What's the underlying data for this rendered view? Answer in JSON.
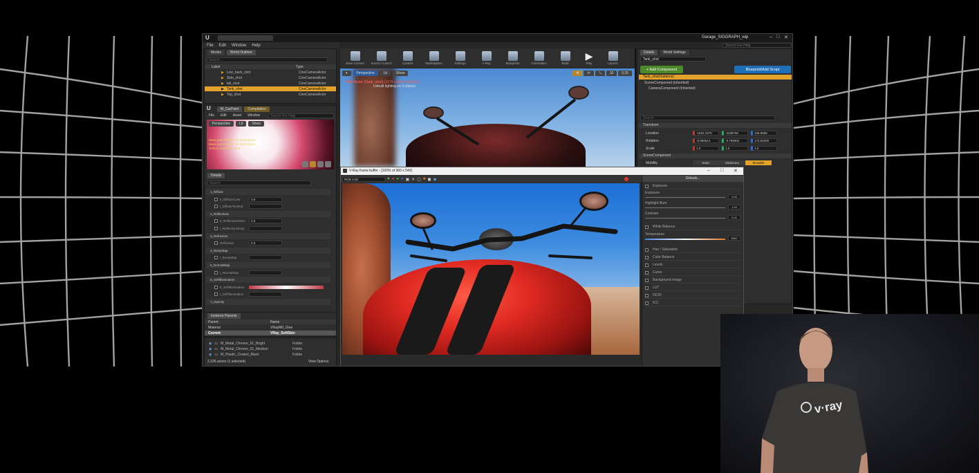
{
  "window": {
    "title": "Garage_SIGGRAPH_wip",
    "search_help_placeholder": "Search For Help",
    "menu": [
      "File",
      "Edit",
      "Window",
      "Help"
    ]
  },
  "outliner": {
    "tabs": [
      "Modes",
      "World Outliner"
    ],
    "search_placeholder": "Search...",
    "col_label": "Label",
    "col_type": "Type",
    "items": [
      {
        "label": "Low_back_shot",
        "type": "CineCameraActor"
      },
      {
        "label": "Side_shot",
        "type": "CineCameraActor"
      },
      {
        "label": "tail_shot",
        "type": "CineCameraActor"
      },
      {
        "label": "Tank_shot",
        "type": "CineCameraActor",
        "selected": true
      },
      {
        "label": "Top_shot",
        "type": "CineCameraActor"
      }
    ],
    "status": "2,226 actors (1 selected)",
    "view_options": "View Options"
  },
  "material_editor": {
    "tabs": [
      "M_CarPaint",
      "Compilation"
    ],
    "menu": [
      "File",
      "Edit",
      "Asset",
      "Window"
    ],
    "search_placeholder": "Search For Help",
    "viewport_buttons": [
      "Perspective",
      "Lit",
      "Show"
    ],
    "stats": [
      "Base pass shader: 93 instructions",
      "Base pass shader: 52 instructions",
      "Texture samplers: 3/16"
    ],
    "details_tab": "Details",
    "search_details": "Search",
    "param_groups": [
      "1_Diffuse",
      "2_Reflections",
      "3_Refraction",
      "4_BumpMap",
      "5_NormalMap",
      "6_SelfIllumination",
      "7_Opacity"
    ],
    "params": [
      {
        "name": "b_DiffuseColor",
        "value": "0.8"
      },
      {
        "name": "t_DiffuseTexMult",
        "value": ""
      },
      {
        "name": "b_ReflectionGloss",
        "value": "0.8"
      },
      {
        "name": "t_ReflectionGloss",
        "value": ""
      },
      {
        "name": "Refraction",
        "value": "0.0"
      },
      {
        "name": "t_BumpMap",
        "value": ""
      },
      {
        "name": "t_NormalMap",
        "value": ""
      },
      {
        "name": "b_SelfIllumination",
        "value": ""
      },
      {
        "name": "t_SelfIllumination",
        "value": ""
      }
    ],
    "instance_tab": "Instance Parents",
    "instance_cols": [
      "Parent",
      "Name"
    ],
    "instance_rows": [
      {
        "parent": "Material",
        "name": "VRayMtl_Glue"
      },
      {
        "parent": "Current",
        "name": "VRay_SoftSkin"
      }
    ]
  },
  "content_rows": [
    "M_Metal_Chrome_01_Bright",
    "M_Metal_Chrome_01_Medium",
    "M_Plastic_Coated_Black"
  ],
  "content_type": "Folder",
  "toolbar": [
    "Save Current",
    "Source Control",
    "Content",
    "Marketplace",
    "Settings",
    "V-Ray",
    "Blueprints",
    "Cinematics",
    "Build",
    "Play",
    "Launch"
  ],
  "viewport": {
    "buttons": [
      "Perspective",
      "Lit",
      "Show"
    ],
    "info": "Pilot Actor (Tank_shot)",
    "info2": "(1975 unbuilt object(s))",
    "sub": "Unbuilt lighting on 3 objects",
    "fov": "10",
    "speed": "0.25"
  },
  "details": {
    "tabs": [
      "Details",
      "World Settings"
    ],
    "actor_name": "Tank_shot",
    "add_component": "+ Add Component",
    "blueprint_script": "Blueprint/Add Script",
    "instance_label": "Tank_shot(Instance)",
    "components": [
      "SceneComponent (Inherited)",
      "CameraComponent (Inherited)"
    ],
    "search_placeholder": "Search",
    "section_transform": "Transform",
    "location_label": "Location",
    "rotation_label": "Rotation",
    "scale_label": "Scale",
    "location": [
      "-1664.3375",
      "-3338750",
      "136.8869"
    ],
    "rotation": [
      "-9.999614",
      "-9.799982",
      "174.80280"
    ],
    "scale": [
      "1.0",
      "1.0",
      "1.0"
    ],
    "scene_section": "SceneComponent",
    "mobility_label": "Mobility",
    "mobility": [
      "Static",
      "Stationary",
      "Movable"
    ]
  },
  "vfb": {
    "title": "V-Ray frame buffer - [100% of 960 x 540]",
    "channel": "RGB color",
    "globals": "Globals...",
    "sections": [
      "Exposure",
      "White Balance",
      "Hue / Saturation",
      "Color Balance",
      "Levels",
      "Curve",
      "Background Image",
      "LUT",
      "OCIO",
      "ICC"
    ],
    "exposure_params": [
      {
        "label": "Exposure",
        "value": "0.00"
      },
      {
        "label": "Highlight Burn",
        "value": "1.00"
      },
      {
        "label": "Contrast",
        "value": "0.00"
      }
    ],
    "wb_label": "Temperature",
    "wb_value": "6500"
  },
  "speaker_shirt": "v·ray"
}
